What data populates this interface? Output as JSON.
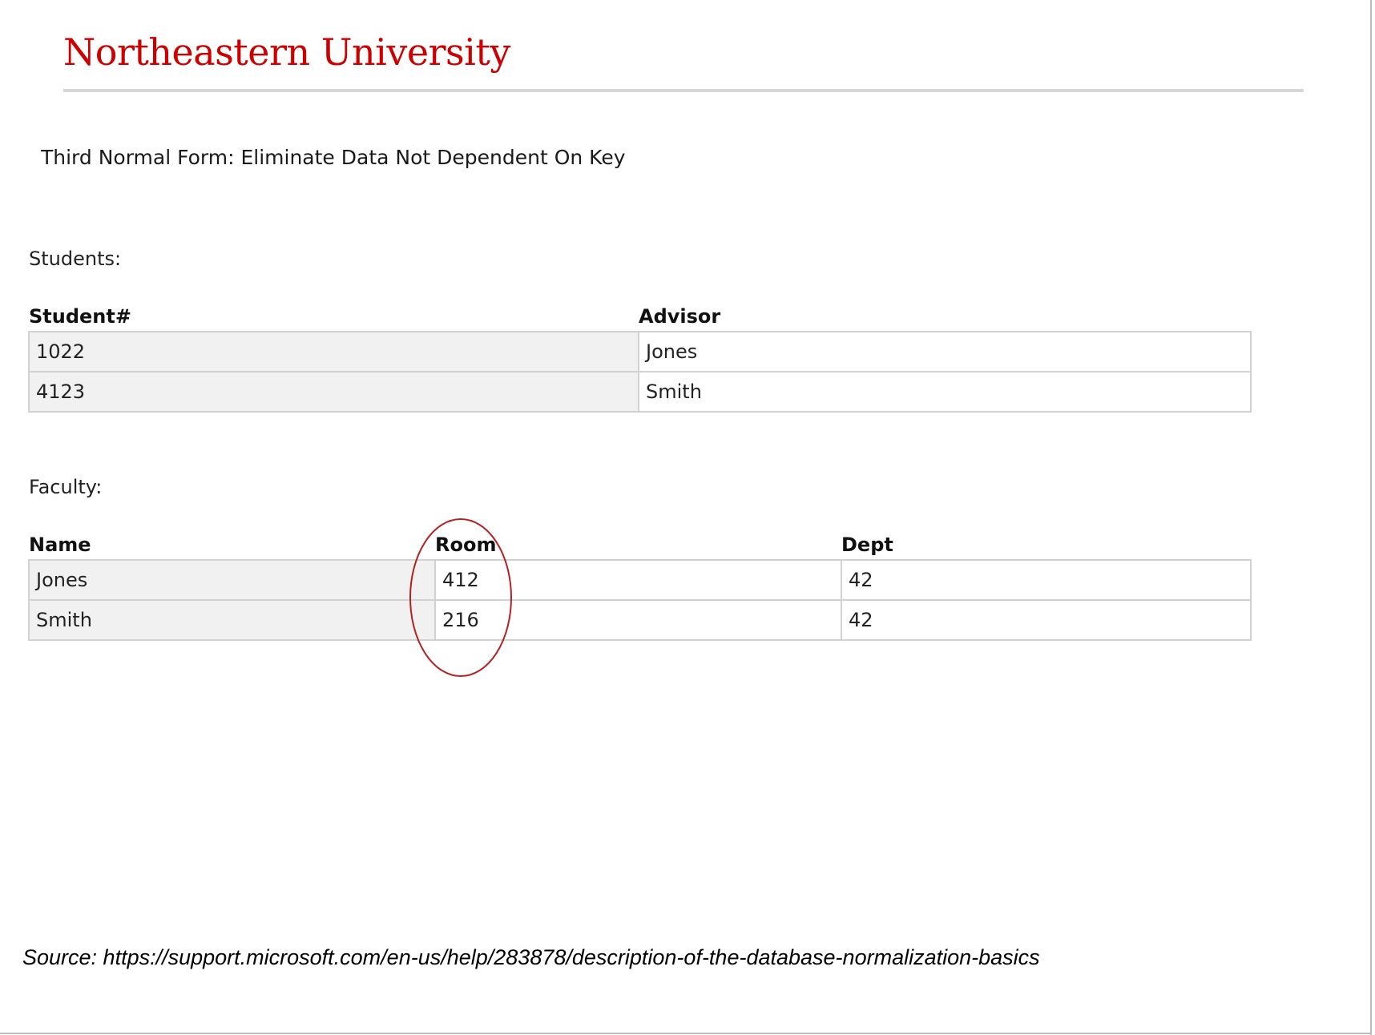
{
  "header": {
    "brand": "Northeastern University"
  },
  "slide": {
    "heading": "Third Normal Form: Eliminate Data Not Dependent On Key"
  },
  "students": {
    "label": "Students:",
    "columns": [
      "Student#",
      "Advisor"
    ],
    "rows": [
      [
        "1022",
        "Jones"
      ],
      [
        "4123",
        "Smith"
      ]
    ]
  },
  "faculty": {
    "label": "Faculty:",
    "columns": [
      "Name",
      "Room",
      "Dept"
    ],
    "rows": [
      [
        "Jones",
        "412",
        "42"
      ],
      [
        "Smith",
        "216",
        "42"
      ]
    ]
  },
  "annotation": {
    "highlighted_column": "Room",
    "color": "#b22222"
  },
  "footer": {
    "source": "Source: https://support.microsoft.com/en-us/help/283878/description-of-the-database-normalization-basics"
  },
  "colors": {
    "brand": "#cc0000",
    "table_border": "#d2d2d2",
    "key_column_fill": "#f1f1f1"
  }
}
